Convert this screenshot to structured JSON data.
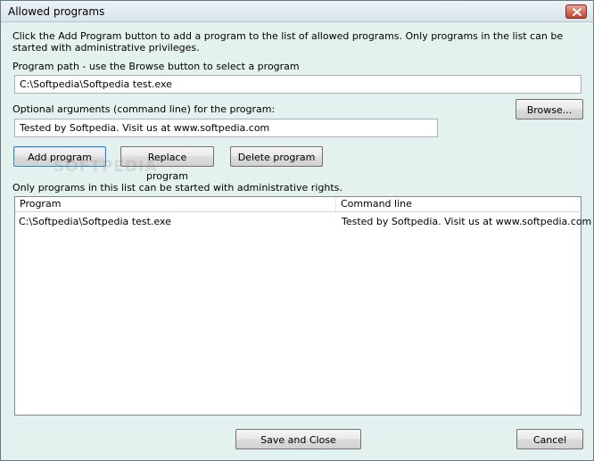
{
  "window": {
    "title": "Allowed programs"
  },
  "intro_text": "Click the Add Program button to add a program to the list of allowed programs. Only programs in the list can be started with administrative privileges.",
  "program_path": {
    "label": "Program path - use the Browse button to select a program",
    "value": "C:\\Softpedia\\Softpedia test.exe"
  },
  "arguments": {
    "label": "Optional arguments (command line) for the program:",
    "value": "Tested by Softpedia. Visit us at www.softpedia.com"
  },
  "buttons": {
    "browse": "Browse...",
    "add": "Add program",
    "replace": "Replace program",
    "delete": "Delete program",
    "save_close": "Save and Close",
    "cancel": "Cancel"
  },
  "list": {
    "caption": "Only programs in this list can be started with administrative rights.",
    "columns": [
      "Program",
      "Command line"
    ],
    "rows": [
      [
        "C:\\Softpedia\\Softpedia test.exe",
        "Tested by Softpedia. Visit us at www.softpedia.com"
      ]
    ]
  },
  "watermark": "SOFTPEDIA"
}
